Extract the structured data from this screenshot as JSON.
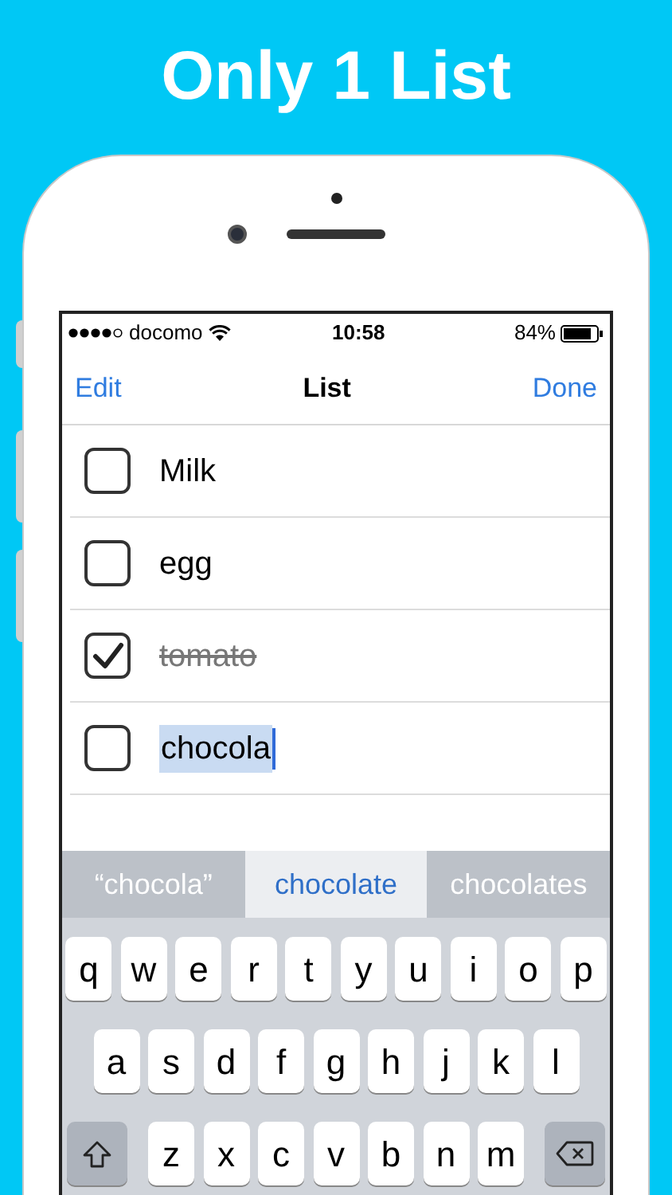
{
  "headline": "Only 1 List",
  "status_bar": {
    "carrier": "docomo",
    "time": "10:58",
    "battery": "84%"
  },
  "nav": {
    "left": "Edit",
    "title": "List",
    "right": "Done"
  },
  "items": [
    {
      "text": "Milk",
      "checked": false,
      "editing": false
    },
    {
      "text": "egg",
      "checked": false,
      "editing": false
    },
    {
      "text": "tomato",
      "checked": true,
      "editing": false
    },
    {
      "text": "chocola",
      "checked": false,
      "editing": true
    }
  ],
  "suggestions": [
    {
      "text": "“chocola”",
      "selected": false
    },
    {
      "text": "chocolate",
      "selected": true
    },
    {
      "text": "chocolates",
      "selected": false
    }
  ],
  "keyboard": {
    "rows": [
      [
        "q",
        "w",
        "e",
        "r",
        "t",
        "y",
        "u",
        "i",
        "o",
        "p"
      ],
      [
        "a",
        "s",
        "d",
        "f",
        "g",
        "h",
        "j",
        "k",
        "l"
      ],
      [
        "z",
        "x",
        "c",
        "v",
        "b",
        "n",
        "m"
      ]
    ]
  }
}
